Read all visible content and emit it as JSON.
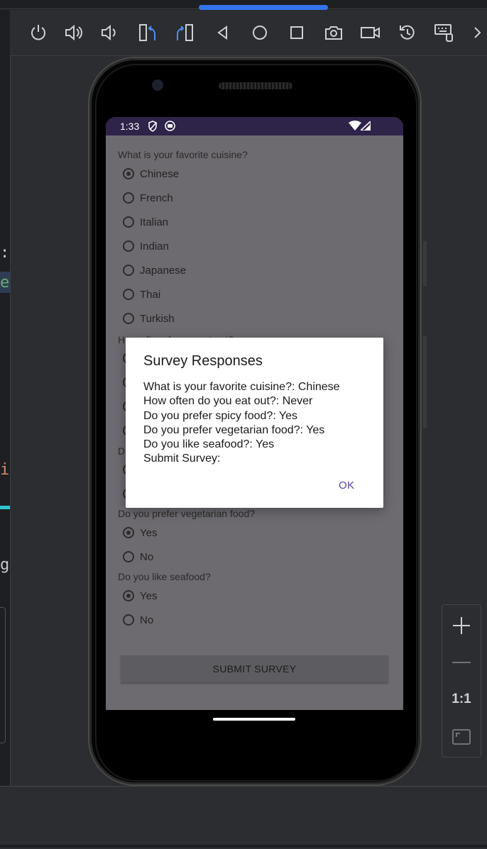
{
  "toolbar": {
    "icons": [
      "power-icon",
      "volume-up-icon",
      "volume-down-icon",
      "rotate-left-icon",
      "rotate-right-icon",
      "back-icon",
      "home-icon",
      "overview-icon",
      "screenshot-icon",
      "screen-record-icon",
      "snapshot-icon",
      "extended-controls-icon",
      "more-icon"
    ]
  },
  "editor_fragments": [
    ":",
    "e",
    "i",
    "g"
  ],
  "zoom_panel": {
    "zoom_in": "+",
    "zoom_out": "—",
    "actual_size": "1:1"
  },
  "status_bar": {
    "time": "1:33"
  },
  "survey": {
    "q1": "What is your favorite cuisine?",
    "q1_options": [
      "Chinese",
      "French",
      "Italian",
      "Indian",
      "Japanese",
      "Thai",
      "Turkish"
    ],
    "q2_partial": "How often do you eat out?",
    "q3_partial": "D",
    "q4": "Do you prefer vegetarian food?",
    "q5": "Do you like seafood?",
    "yes": "Yes",
    "no": "No",
    "submit": "SUBMIT SURVEY"
  },
  "dialog": {
    "title": "Survey Responses",
    "lines": [
      "What is your favorite cuisine?: Chinese",
      "How often do you eat out?: Never",
      "Do you prefer spicy food?: Yes",
      "Do you prefer vegetarian food?: Yes",
      "Do you like seafood?: Yes",
      "Submit Survey:"
    ],
    "ok": "OK"
  },
  "colors": {
    "accent": "#3574f0",
    "status_bar": "#2e2349",
    "ok_text": "#5b3f9a",
    "scrim_screen": "#6d6b70"
  }
}
